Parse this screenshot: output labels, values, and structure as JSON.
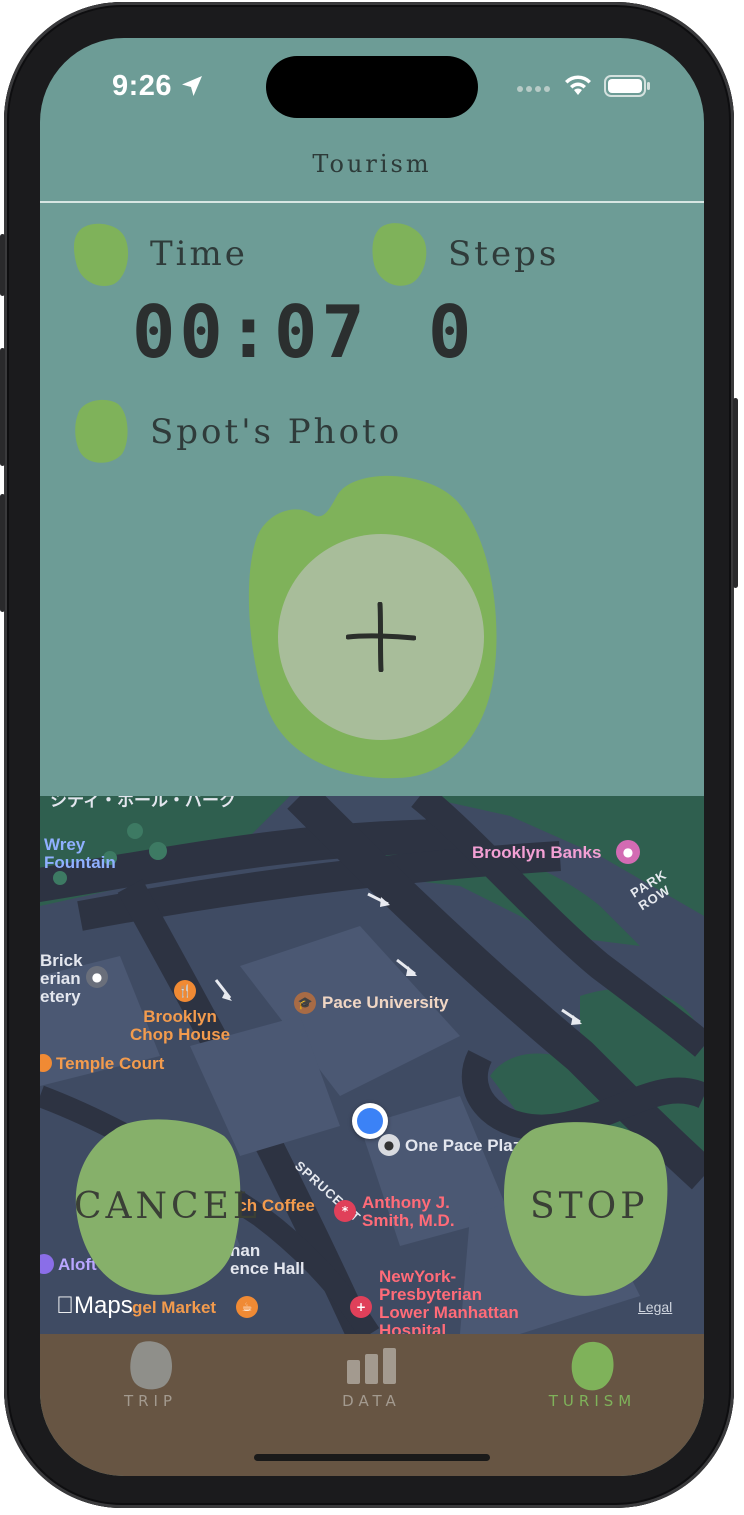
{
  "status_bar": {
    "time": "9:26"
  },
  "nav": {
    "title": "Tourism"
  },
  "stats": {
    "time_label": "Time",
    "time_value": "00:07",
    "steps_label": "Steps",
    "steps_value": "0",
    "photo_label": "Spot's Photo"
  },
  "photo_add": {
    "icon": "plus-icon"
  },
  "map": {
    "pois": {
      "wrey_fountain": "Wrey\nFountain",
      "brooklyn_banks": "Brooklyn Banks",
      "park_row": "PARK ROW",
      "brick_cemetery": "Brick\nerian\netery",
      "pace_university": "Pace University",
      "brooklyn_chop_house": "Brooklyn\nChop House",
      "temple_court": "Temple Court",
      "one_pace_plaza": "One Pace Plaza",
      "spruce_st": "SPRUCE ST",
      "birch_coffee": "irch Coffee",
      "anthony_smith": "Anthony J.\nSmith, M.D.",
      "aloft": "Aloft",
      "hall": "han\nence Hall",
      "gel_market": "gel Market",
      "newyork_presbyterian": "NewYork-\nPresbyterian\nLower Manhattan\nHospital",
      "top_cut": "シティ・ホール・パーク"
    },
    "maps_label": "Maps",
    "legal_label": "Legal"
  },
  "actions": {
    "cancel_label": "CANCEL",
    "stop_label": "STOP"
  },
  "tabbar": {
    "tabs": [
      {
        "label": "TRIP",
        "icon": "leaf-icon"
      },
      {
        "label": "DATA",
        "icon": "bar-chart-icon"
      },
      {
        "label": "TURISM",
        "icon": "leaf-icon"
      }
    ],
    "active_color": "#7fb25a",
    "inactive_color": "#a39a8f"
  },
  "colors": {
    "background": "#6d9c96",
    "leaf": "#7fb25a",
    "tabbar": "#675543"
  }
}
